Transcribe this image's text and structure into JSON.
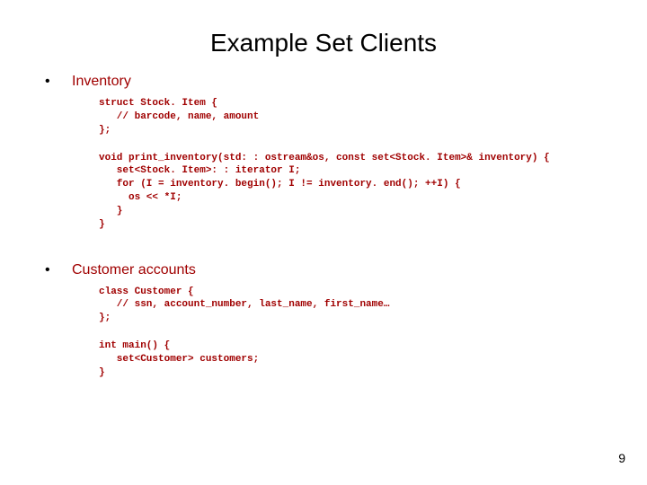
{
  "title": "Example Set Clients",
  "bullets": {
    "b1_label": "Inventory",
    "b2_label": "Customer accounts"
  },
  "code": {
    "struct_stockitem": "struct Stock. Item {\n   // barcode, name, amount\n};",
    "print_inventory": "void print_inventory(std: : ostream&os, const set<Stock. Item>& inventory) {\n   set<Stock. Item>: : iterator I;\n   for (I = inventory. begin(); I != inventory. end(); ++I) {\n     os << *I;\n   }\n}",
    "class_customer": "class Customer {\n   // ssn, account_number, last_name, first_name…\n};",
    "main_fn": "int main() {\n   set<Customer> customers;\n}"
  },
  "page_number": "9"
}
